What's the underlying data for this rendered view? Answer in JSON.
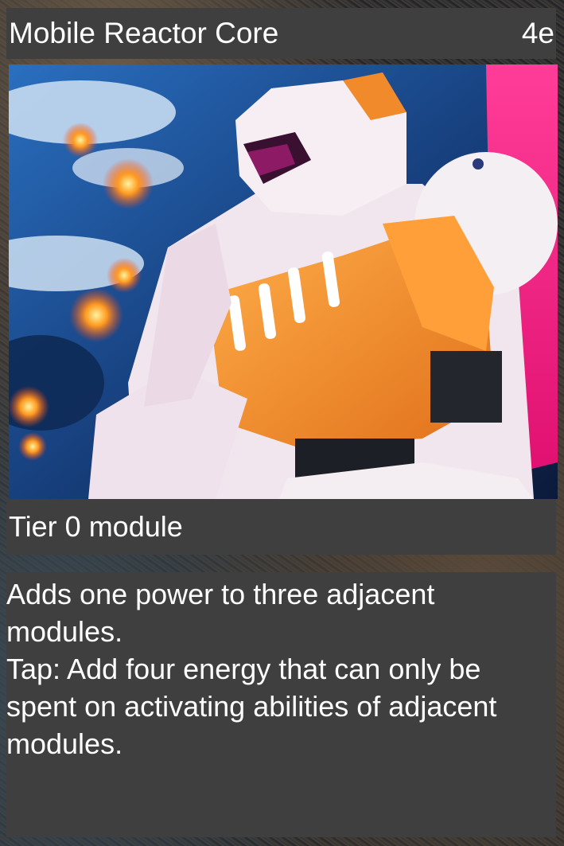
{
  "card": {
    "name": "Mobile Reactor Core",
    "cost": "4e",
    "type_line": "Tier 0  module",
    "rules": [
      "Adds one power to three adjacent modules.",
      "Tap: Add four energy that can only be spent on activating abilities of adjacent modules."
    ],
    "art_subject": "orange-and-white-mech-in-orbit-illustration"
  },
  "colors": {
    "panel": "#3f3f3f",
    "text": "#ffffff",
    "mech_orange": "#f0892a",
    "mech_white": "#f3eef2",
    "space_blue": "#1b4e9a",
    "accent_pink": "#ff2a8a"
  }
}
